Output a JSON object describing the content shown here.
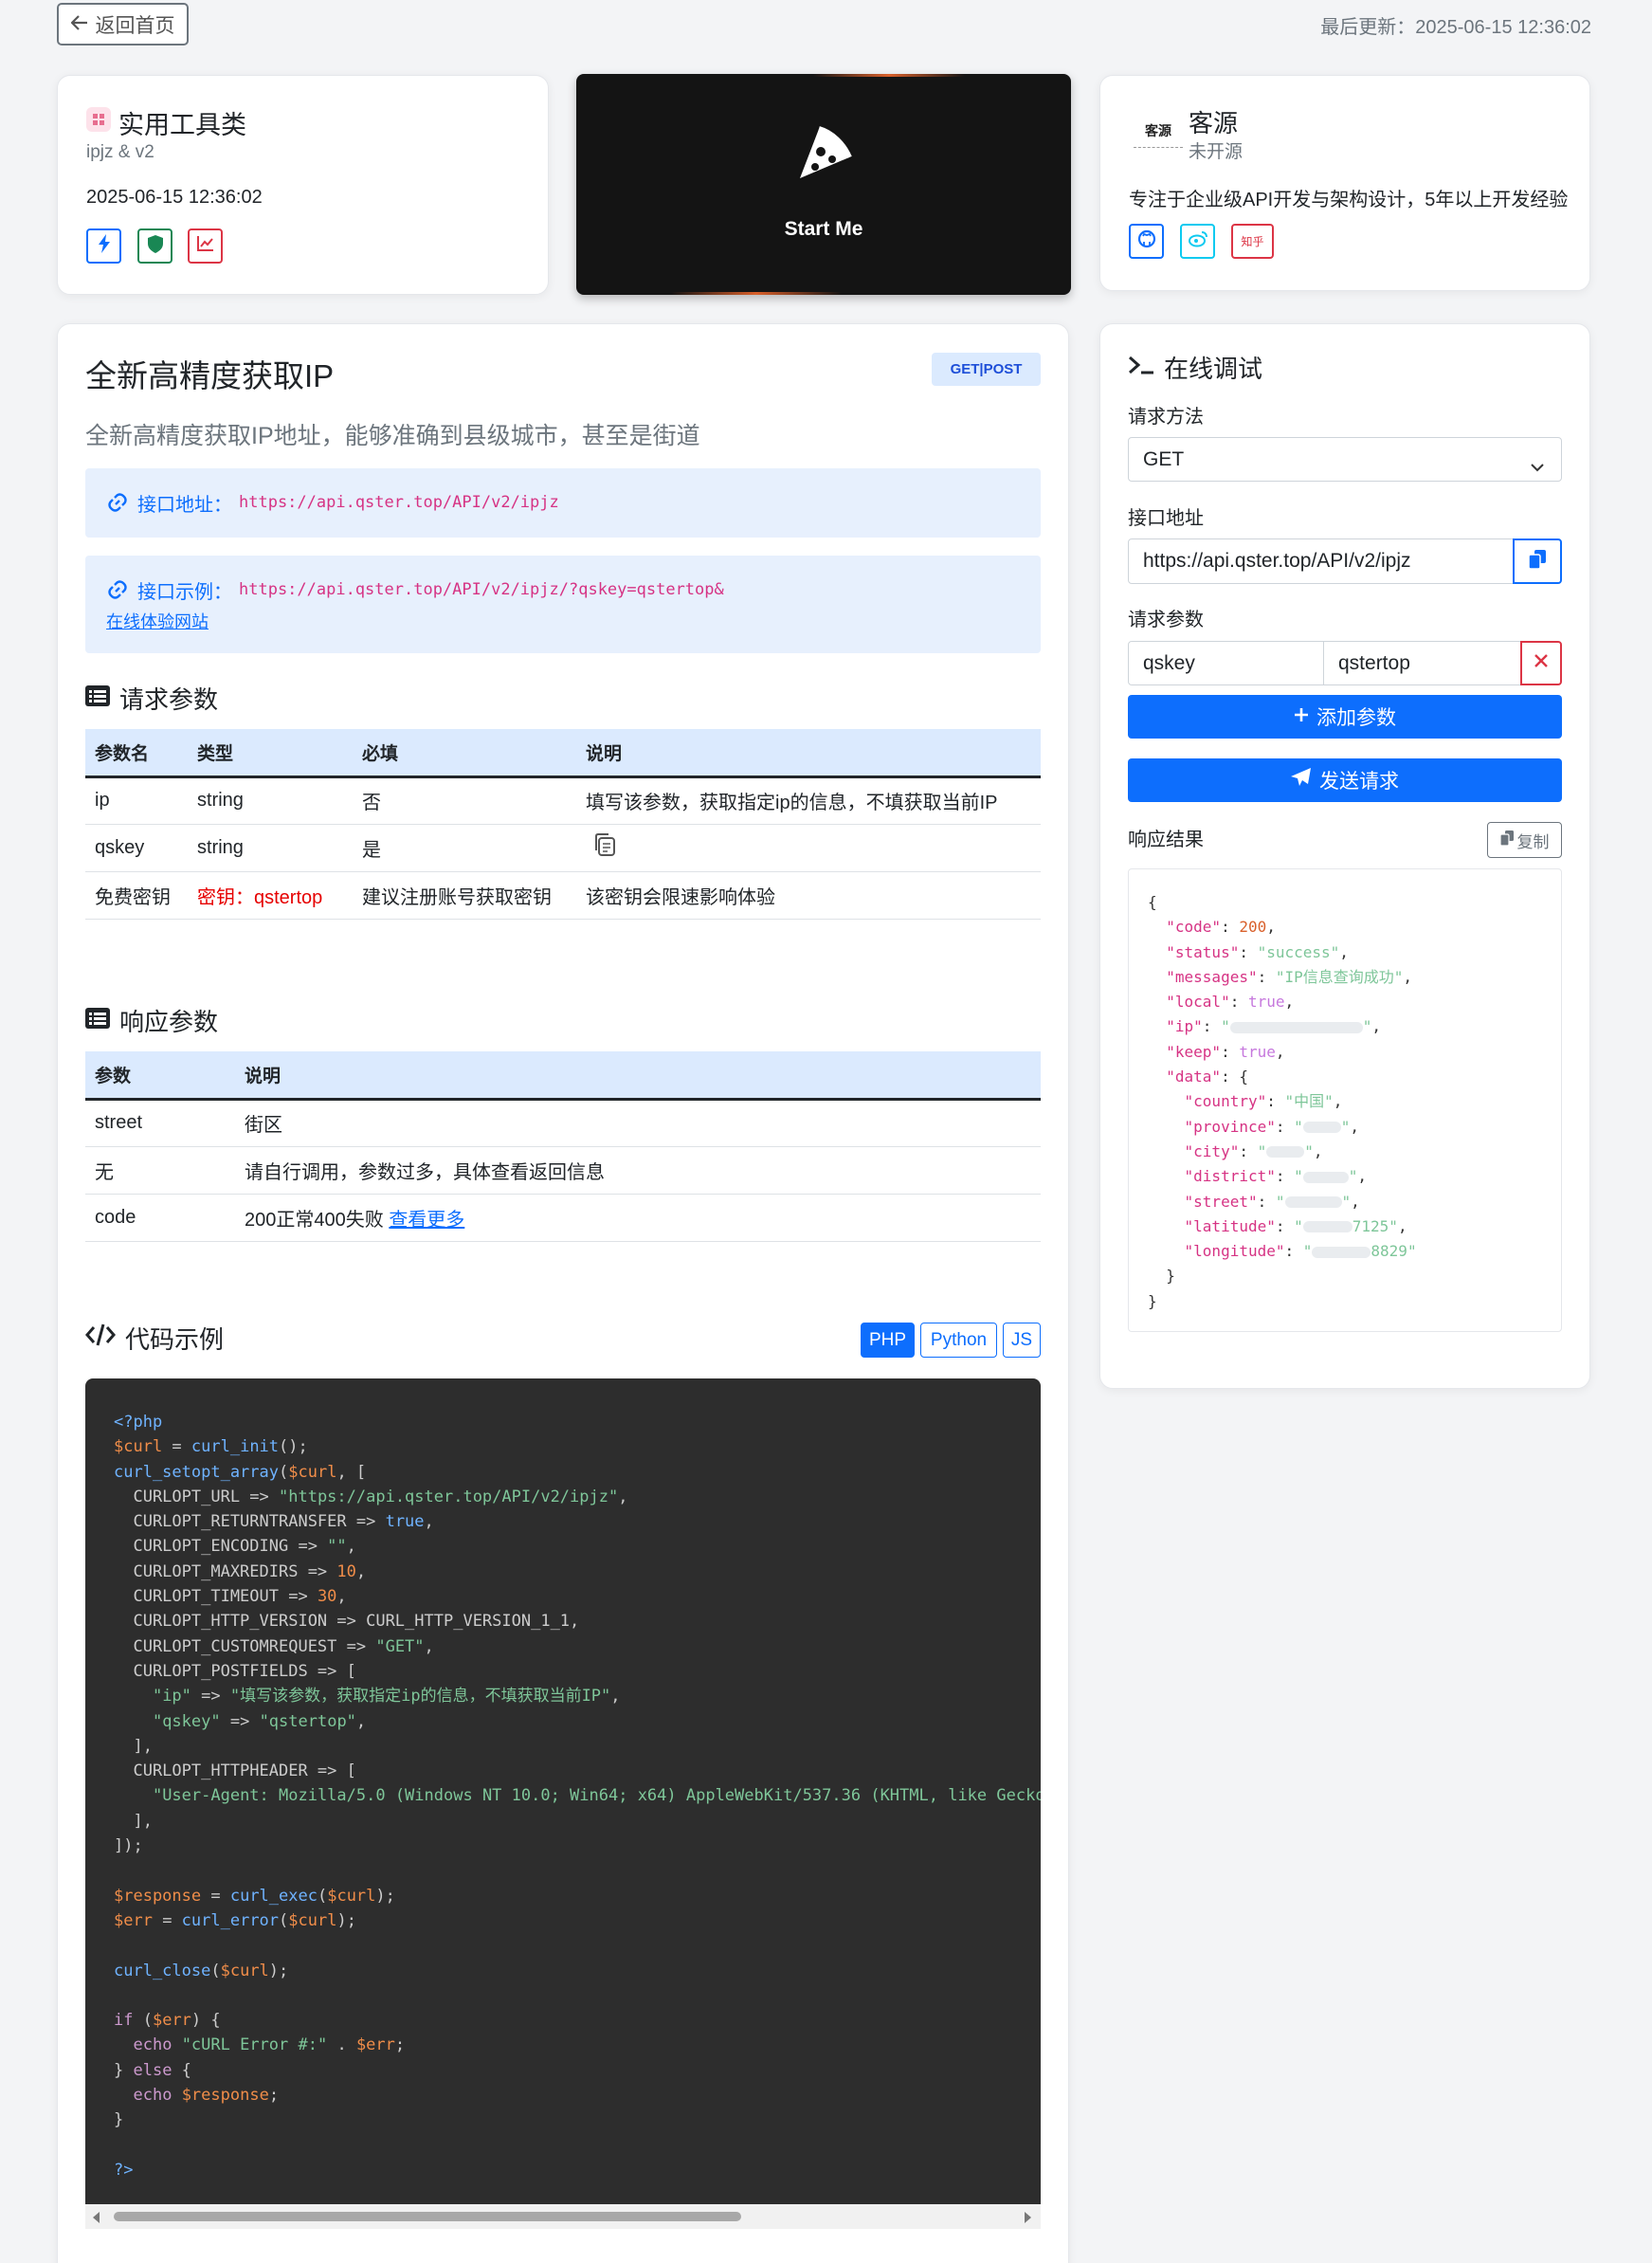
{
  "topbar": {
    "back_label": "返回首页",
    "updated_label": "最后更新：",
    "updated_value": "2025-06-15 12:36:02"
  },
  "category_card": {
    "title": "实用工具类",
    "subtitle": "ipjz & v2",
    "date": "2025-06-15 12:36:02",
    "icons": [
      "bolt-icon",
      "shield-icon",
      "chart-icon"
    ]
  },
  "banner": {
    "label": "Start Me",
    "icon": "pizza-icon"
  },
  "author_card": {
    "name": "客源",
    "logo_text": "客源",
    "status": "未开源",
    "bio": "专注于企业级API开发与架构设计，5年以上开发经验",
    "socials": [
      {
        "icon": "github-icon",
        "color": "#0d6efd"
      },
      {
        "icon": "weibo-icon",
        "color": "#0dcaf0"
      },
      {
        "icon": "zhihu-icon",
        "label": "知乎",
        "color": "#dc3545"
      }
    ]
  },
  "api": {
    "title": "全新高精度获取IP",
    "method": "GET|POST",
    "description": "全新高精度获取IP地址，能够准确到县级城市，甚至是街道",
    "endpoint_label": "接口地址：",
    "endpoint": "https://api.qster.top/API/v2/ipjz",
    "example_label": "接口示例：",
    "example": "https://api.qster.top/API/v2/ipjz/?qskey=qstertop&",
    "demo_link": "在线体验网站"
  },
  "request_params": {
    "section_title": "请求参数",
    "headers": [
      "参数名",
      "类型",
      "必填",
      "说明"
    ],
    "rows": [
      {
        "name": "ip",
        "type": "string",
        "required": "否",
        "desc": "填写该参数，获取指定ip的信息，不填获取当前IP"
      },
      {
        "name": "qskey",
        "type": "string",
        "required": "是",
        "desc": ""
      },
      {
        "name": "免费密钥",
        "type": "密钥：qstertop",
        "required": "建议注册账号获取密钥",
        "desc": "该密钥会限速影响体验"
      }
    ]
  },
  "response_params": {
    "section_title": "响应参数",
    "headers": [
      "参数",
      "说明"
    ],
    "rows": [
      {
        "name": "street",
        "desc": "街区"
      },
      {
        "name": "无",
        "desc": "请自行调用，参数过多，具体查看返回信息"
      },
      {
        "name": "code",
        "desc": "200正常400失败",
        "link": "查看更多"
      }
    ]
  },
  "code_example": {
    "section_title": "代码示例",
    "tabs": [
      "PHP",
      "Python",
      "JS"
    ],
    "active_tab": "PHP"
  },
  "debug": {
    "title": "在线调试",
    "method_label": "请求方法",
    "method_value": "GET",
    "url_label": "接口地址",
    "url_value": "https://api.qster.top/API/v2/ipjz",
    "params_label": "请求参数",
    "param_key": "qskey",
    "param_value": "qstertop",
    "add_param": "添加参数",
    "send": "发送请求",
    "result_label": "响应结果",
    "copy": "复制"
  }
}
